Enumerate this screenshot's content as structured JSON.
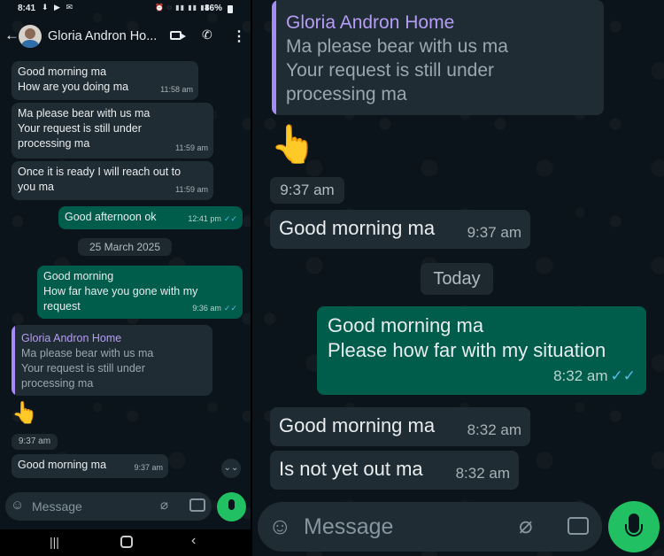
{
  "status_bar": {
    "time": "8:41",
    "battery": "86%"
  },
  "header": {
    "contact_name": "Gloria Andron Ho..."
  },
  "left": {
    "msg1": {
      "lines": [
        "Good morning ma",
        "How are you doing ma"
      ],
      "time": "11:58 am"
    },
    "msg2": {
      "lines": [
        "Ma please bear with us ma",
        "Your request is still under",
        "processing ma"
      ],
      "time": "11:59 am"
    },
    "msg3": {
      "lines": [
        "Once it is ready I will reach out to",
        "you ma"
      ],
      "time": "11:59 am"
    },
    "msg4": {
      "text": "Good afternoon  ok",
      "time": "12:41 pm"
    },
    "date": "25 March 2025",
    "msg5": {
      "lines": [
        "Good morning",
        "How  far have you gone with my",
        "request"
      ],
      "time": "9:36 am"
    },
    "quote": {
      "name": "Gloria Andron Home",
      "lines": [
        "Ma please bear with us ma",
        "Your request is still under",
        "processing ma"
      ]
    },
    "emoji": "👆",
    "emoji_time": "9:37 am",
    "msg6": {
      "text": "Good morning ma",
      "time": "9:37 am"
    },
    "input_placeholder": "Message"
  },
  "right": {
    "quote": {
      "name": "Gloria Andron Home",
      "lines": [
        "Ma please bear with us ma",
        "Your request is still under",
        "processing ma"
      ]
    },
    "emoji": "👆",
    "emoji_time": "9:37 am",
    "msg1": {
      "text": "Good morning ma",
      "time": "9:37 am"
    },
    "date": "Today",
    "msg2": {
      "lines": [
        "Good morning ma",
        "Please how far with my situation"
      ],
      "time": "8:32 am"
    },
    "msg3": {
      "text": "Good morning ma",
      "time": "8:32 am"
    },
    "msg4": {
      "text": "Is not yet out ma",
      "time": "8:32 am"
    },
    "input_placeholder": "Message"
  },
  "colors": {
    "incoming": "#202c33",
    "outgoing": "#005c4b",
    "accent": "#21c063",
    "quote_bar": "#a58af8",
    "read_tick": "#53bdeb"
  }
}
